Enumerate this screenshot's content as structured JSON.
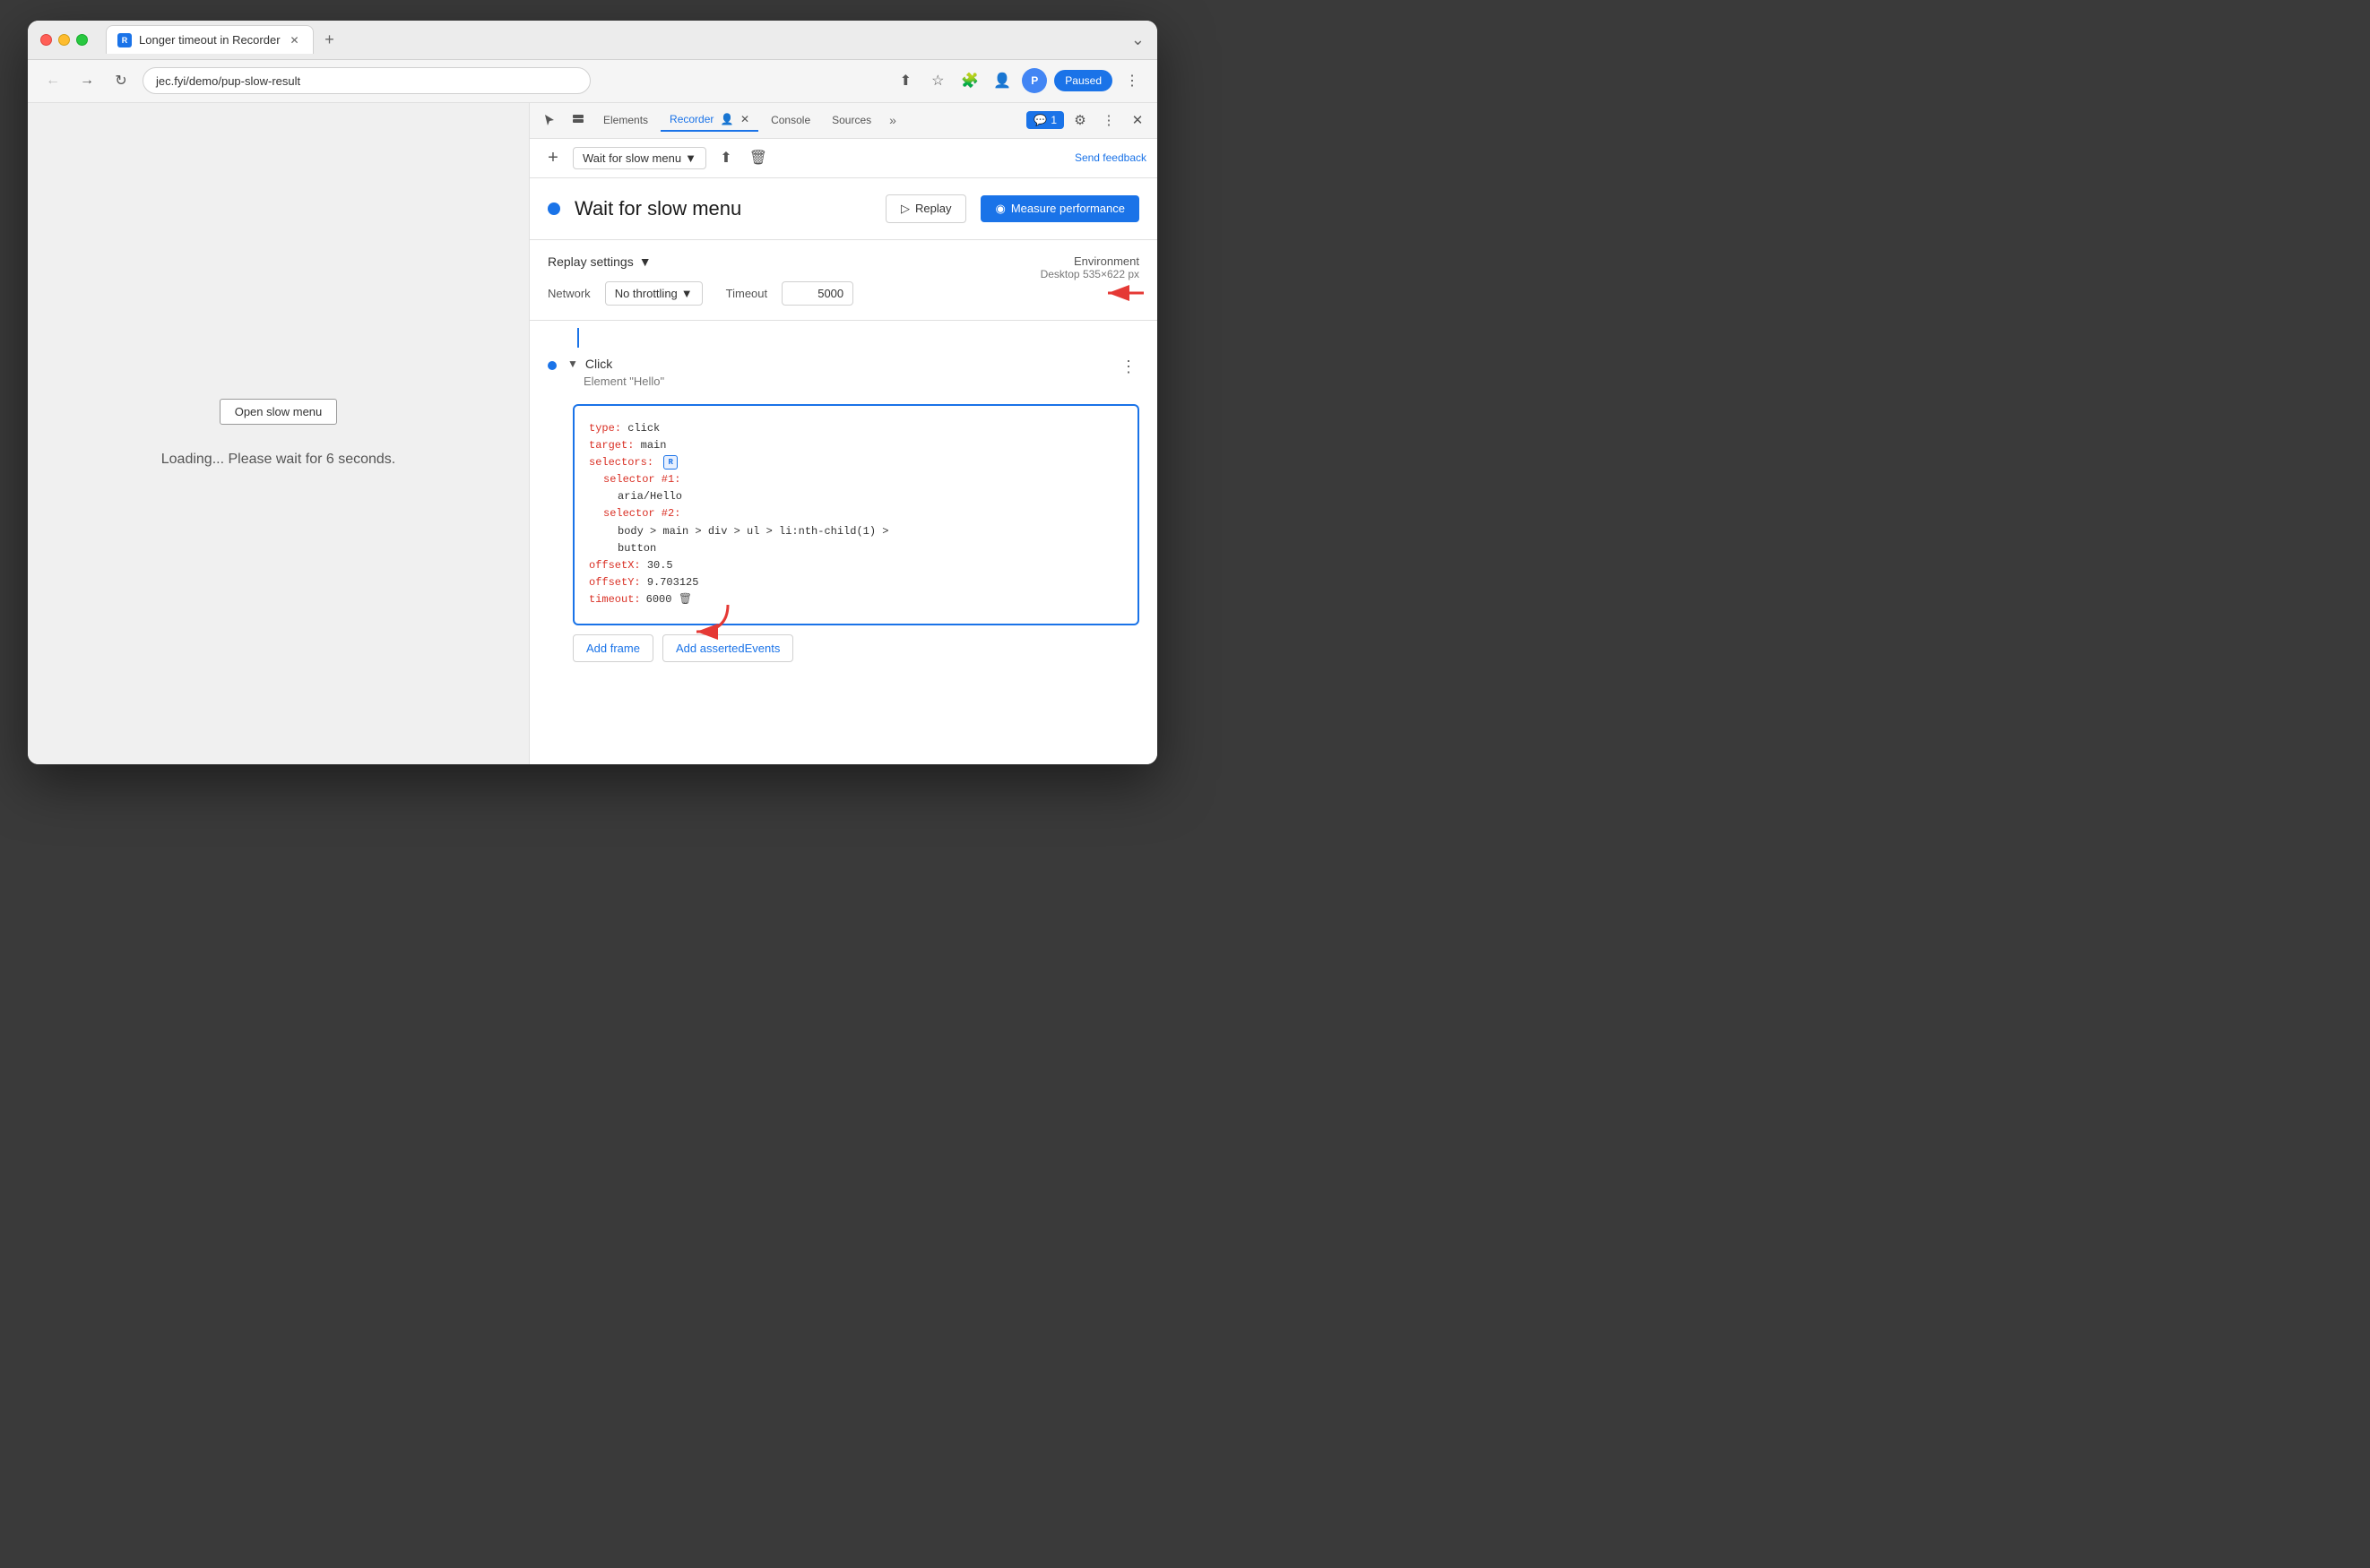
{
  "browser": {
    "tab_title": "Longer timeout in Recorder",
    "tab_favicon": "R",
    "url": "jec.fyi/demo/pup-slow-result",
    "paused_label": "Paused",
    "window_control_chevron": "⌄"
  },
  "devtools": {
    "tabs": [
      {
        "id": "elements",
        "label": "Elements",
        "active": false
      },
      {
        "id": "recorder",
        "label": "Recorder",
        "active": true
      },
      {
        "id": "console",
        "label": "Console",
        "active": false
      },
      {
        "id": "sources",
        "label": "Sources",
        "active": false
      }
    ],
    "chat_badge": "1",
    "more_tabs": "»"
  },
  "recorder": {
    "add_label": "+",
    "recording_name": "Wait for slow menu",
    "send_feedback": "Send feedback",
    "recording_title": "Wait for slow menu",
    "replay_label": "Replay",
    "measure_label": "Measure performance",
    "replay_settings_label": "Replay settings",
    "network_label": "Network",
    "network_value": "No throttling",
    "timeout_label": "Timeout",
    "timeout_value": "5000",
    "environment_label": "Environment",
    "environment_name": "Desktop",
    "environment_size": "535×622 px"
  },
  "step": {
    "type": "Click",
    "description": "Element \"Hello\"",
    "code": {
      "type_key": "type",
      "type_val": "click",
      "target_key": "target",
      "target_val": "main",
      "selectors_key": "selectors",
      "selector_icon": "R",
      "selector1_key": "selector #1",
      "selector1_val": "aria/Hello",
      "selector2_key": "selector #2",
      "selector2_val": "body > main > div > ul > li:nth-child(1) >",
      "selector2_val2": "button",
      "offsetx_key": "offsetX",
      "offsetx_val": "30.5",
      "offsety_key": "offsetY",
      "offsety_val": "9.703125",
      "timeout_key": "timeout",
      "timeout_val": "6000"
    },
    "add_frame": "Add frame",
    "add_asserted": "Add assertedEvents"
  },
  "page": {
    "open_menu_label": "Open slow menu",
    "loading_text": "Loading... Please wait for 6 seconds."
  },
  "icons": {
    "back": "←",
    "forward": "→",
    "refresh": "↻",
    "share": "⬆",
    "bookmark": "☆",
    "extension": "🧩",
    "profile": "👤",
    "more_vert": "⋮",
    "close": "✕",
    "cursor": "⊹",
    "layers": "⊟",
    "gear": "⚙",
    "upload": "⬆",
    "trash": "🗑",
    "chevron_down": "▼",
    "play": "▷",
    "gauge": "◉",
    "chat": "💬",
    "more_horiz": "⋯"
  }
}
